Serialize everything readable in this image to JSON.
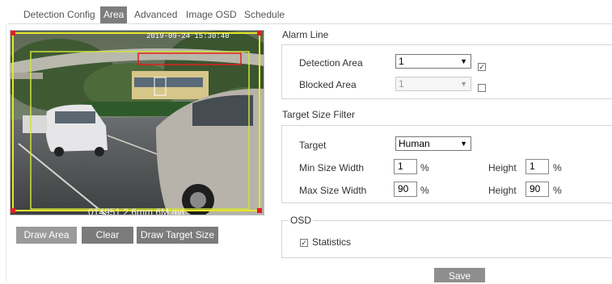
{
  "tabs": [
    "Detection Config",
    "Area",
    "Advanced",
    "Image OSD",
    "Schedule"
  ],
  "active_tab": "Area",
  "video": {
    "osd_time_text": "2019-09-24 15:30:40",
    "filename_text": "014951 2.6mm 6M avi"
  },
  "buttons": {
    "draw_area": "Draw Area",
    "clear": "Clear",
    "draw_target_size": "Draw Target Size",
    "save": "Save"
  },
  "alarm_line": {
    "title": "Alarm Line",
    "detection_area_label": "Detection Area",
    "detection_area_value": "1",
    "detection_area_checked": true,
    "blocked_area_label": "Blocked Area",
    "blocked_area_value": "1",
    "blocked_area_checked": false
  },
  "target_size": {
    "title": "Target Size Filter",
    "target_label": "Target",
    "target_value": "Human",
    "min_width_label": "Min Size Width",
    "min_width_value": "1",
    "max_width_label": "Max Size Width",
    "max_width_value": "90",
    "height_label": "Height",
    "min_height_value": "1",
    "max_height_value": "90",
    "unit": "%"
  },
  "osd": {
    "legend": "OSD",
    "statistics_label": "Statistics",
    "statistics_checked": true
  },
  "colors": {
    "active_tab_bg": "#7d7d7d",
    "button_bg": "#7b7b7b",
    "area_border": "#e6e62a",
    "area_corner": "#e02020"
  }
}
